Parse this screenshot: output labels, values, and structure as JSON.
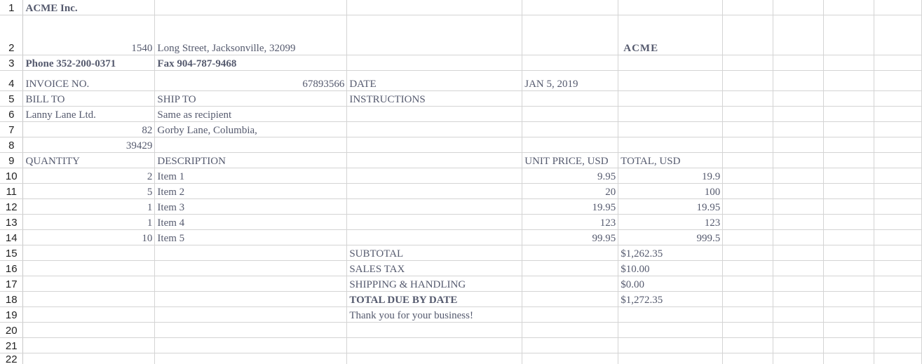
{
  "row_numbers": [
    "1",
    "2",
    "3",
    "4",
    "5",
    "6",
    "7",
    "8",
    "9",
    "10",
    "11",
    "12",
    "13",
    "14",
    "15",
    "16",
    "17",
    "18",
    "19",
    "20",
    "21",
    "22"
  ],
  "company": {
    "name": "ACME Inc.",
    "street_number": "1540",
    "street": "Long Street, Jacksonville, 32099",
    "logo": "ACME",
    "phone": "Phone 352-200-0371",
    "fax": "Fax 904-787-9468"
  },
  "invoice": {
    "label": "INVOICE NO.",
    "number": "67893566",
    "date_label": "DATE",
    "date": "JAN 5, 2019"
  },
  "bill_to": {
    "label": "BILL TO",
    "name": "Lanny Lane Ltd.",
    "street_number": "82",
    "zip": "39429"
  },
  "ship_to": {
    "label": "SHIP TO",
    "name": "Same as recipient",
    "address": "Gorby Lane, Columbia,"
  },
  "instructions_label": "INSTRUCTIONS",
  "items_header": {
    "quantity": "QUANTITY",
    "description": "DESCRIPTION",
    "unit_price": "UNIT PRICE, USD",
    "total": "TOTAL, USD"
  },
  "items": [
    {
      "qty": "2",
      "desc": "Item 1",
      "price": "9.95",
      "total": "19.9"
    },
    {
      "qty": "5",
      "desc": "Item 2",
      "price": "20",
      "total": "100"
    },
    {
      "qty": "1",
      "desc": "Item 3",
      "price": "19.95",
      "total": "19.95"
    },
    {
      "qty": "1",
      "desc": "Item 4",
      "price": "123",
      "total": "123"
    },
    {
      "qty": "10",
      "desc": "Item 5",
      "price": "99.95",
      "total": "999.5"
    }
  ],
  "summary": {
    "subtotal_label": "SUBTOTAL",
    "subtotal": "$1,262.35",
    "tax_label": "SALES TAX",
    "tax": "$10.00",
    "shipping_label": "SHIPPING & HANDLING",
    "shipping": "$0.00",
    "total_label": "TOTAL DUE BY DATE",
    "total": "$1,272.35",
    "thanks": "Thank you for your business!"
  }
}
